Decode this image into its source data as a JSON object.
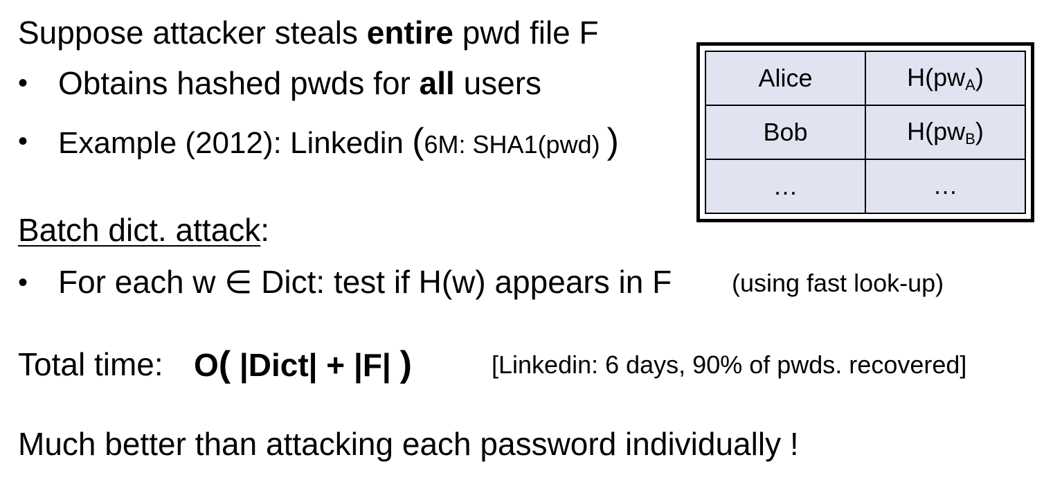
{
  "line1": {
    "pre": "Suppose attacker steals ",
    "bold": "entire",
    "post": " pwd file F"
  },
  "bullet1": {
    "pre": "Obtains hashed pwds for ",
    "bold": "all",
    "post": " users"
  },
  "bullet2": {
    "pre": "Example (2012):   Linkedin  ",
    "paren_open": "(",
    "detail": "6M:  SHA1(pwd) ",
    "paren_close": ")"
  },
  "batch_heading": {
    "label": "Batch dict. attack",
    "colon": ":"
  },
  "bullet3": {
    "main": "For each w ∈ Dict:   test if  H(w)  appears in F",
    "note": "(using fast look-up)"
  },
  "total_time": {
    "label": "Total time:",
    "formula_o": "O",
    "formula_paren_open": "(",
    "formula_body": " |Dict| + |F| ",
    "formula_paren_close": ")",
    "note": "[Linkedin:  6 days,  90% of pwds. recovered]"
  },
  "conclusion": "Much better than attacking each password individually !",
  "pwd_table": {
    "rows": [
      {
        "user": "Alice",
        "hash_base": "H(pw",
        "hash_sub": "A",
        "hash_end": ")"
      },
      {
        "user": "Bob",
        "hash_base": "H(pw",
        "hash_sub": "B",
        "hash_end": ")"
      },
      {
        "user": "…",
        "hash_base": "…",
        "hash_sub": "",
        "hash_end": ""
      }
    ]
  },
  "bullet_char": "•"
}
